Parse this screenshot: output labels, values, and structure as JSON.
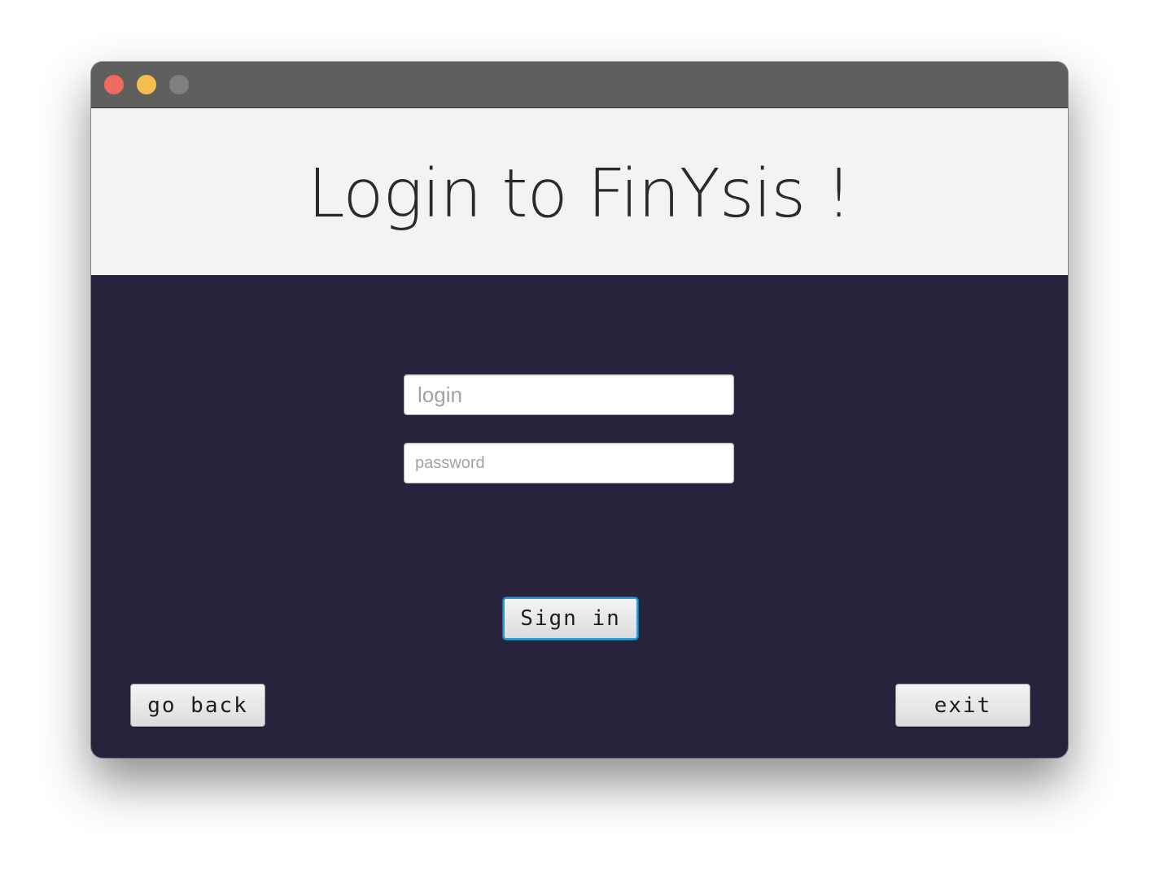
{
  "window": {
    "controls": {
      "close_color": "#ee6a5f",
      "minimize_color": "#f5bf4f",
      "maximize_color": "#7f807e"
    },
    "background_color": "#27233c",
    "titlebar_color": "#5f605e"
  },
  "header": {
    "title": "Login to FinYsis !",
    "background_color": "#f3f3f3"
  },
  "form": {
    "login_placeholder": "login",
    "login_value": "",
    "password_placeholder": "password",
    "password_value": "",
    "signin_label": "Sign in",
    "focus_color": "#2b9bd6"
  },
  "footer": {
    "back_label": "go back",
    "exit_label": "exit"
  }
}
